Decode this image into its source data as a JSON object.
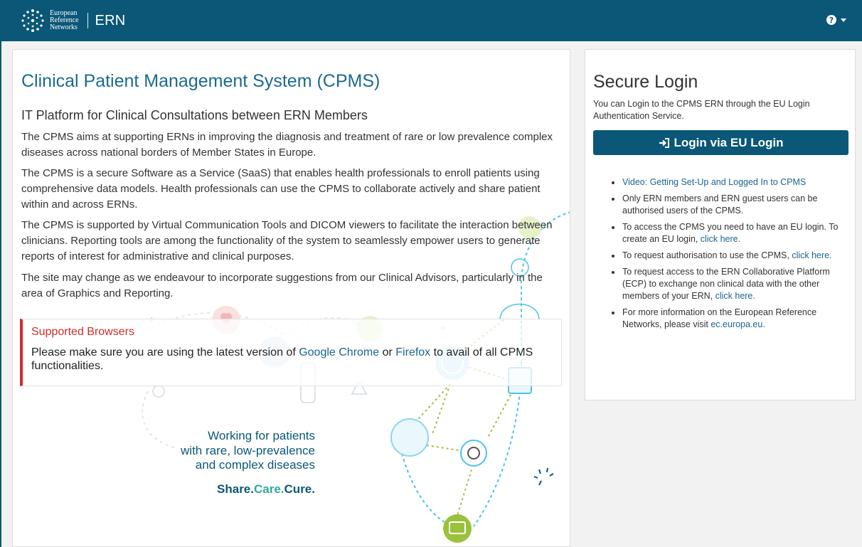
{
  "header": {
    "logo_lines": [
      "European",
      "Reference",
      "Networks"
    ],
    "brand": "ERN",
    "help_icon": "question-circle-icon",
    "accent": "#0b5777"
  },
  "main": {
    "title": "Clinical Patient Management System (CPMS)",
    "subtitle": "IT Platform for Clinical Consultations between ERN Members",
    "paragraphs": [
      "The CPMS aims at supporting ERNs in improving the diagnosis and treatment of rare or low prevalence complex diseases across national borders of Member States in Europe.",
      "The CPMS is a secure Software as a Service (SaaS) that enables health professionals to enroll patients using comprehensive data models. Health professionals can use the CPMS to collaborate actively and share patient within and across ERNs.",
      "The CPMS is supported by Virtual Communication Tools and DICOM viewers to facilitate the interaction between clinicians. Reporting tools are among the functionality of the system to seamlessly empower users to generate reports of interest for administrative and clinical purposes.",
      "The site may change as we endeavour to incorporate suggestions from our Clinical Advisors, particularly in the area of Graphics and Reporting."
    ],
    "browsers": {
      "title": "Supported Browsers",
      "text_before": "Please make sure you are using the latest version of ",
      "chrome_link": "Google Chrome",
      "text_mid": " or ",
      "firefox_link": "Firefox",
      "text_after": " to avail of all CPMS functionalities.",
      "accent": "#d02c2c"
    },
    "tagline": [
      "Working for patients",
      "with rare, low-prevalence",
      "and complex diseases"
    ],
    "motto": {
      "share": "Share.",
      "care": "Care.",
      "cure": "Cure."
    }
  },
  "login": {
    "title": "Secure Login",
    "intro": "You can Login to the CPMS ERN through the EU Login Authentication Service.",
    "button_label": "Login via EU Login",
    "items": {
      "video_link": "Video: Getting Set-Up and Logged In to CPMS",
      "members": "Only ERN members and ERN guest users can be authorised users of the CPMS.",
      "access_text": "To access the CPMS you need to have an EU login. To create an EU login, ",
      "access_link": "click here.",
      "auth_text": "To request authorisation to use the CPMS, ",
      "auth_link": "click here.",
      "ecp_text": "To request access to the ERN Collaborative Platform (ECP) to exchange non clinical data with the other members of your ERN, ",
      "ecp_link": "click here.",
      "info_text": "For more information on the European Reference Networks, please visit ",
      "info_link": "ec.europa.eu."
    }
  }
}
